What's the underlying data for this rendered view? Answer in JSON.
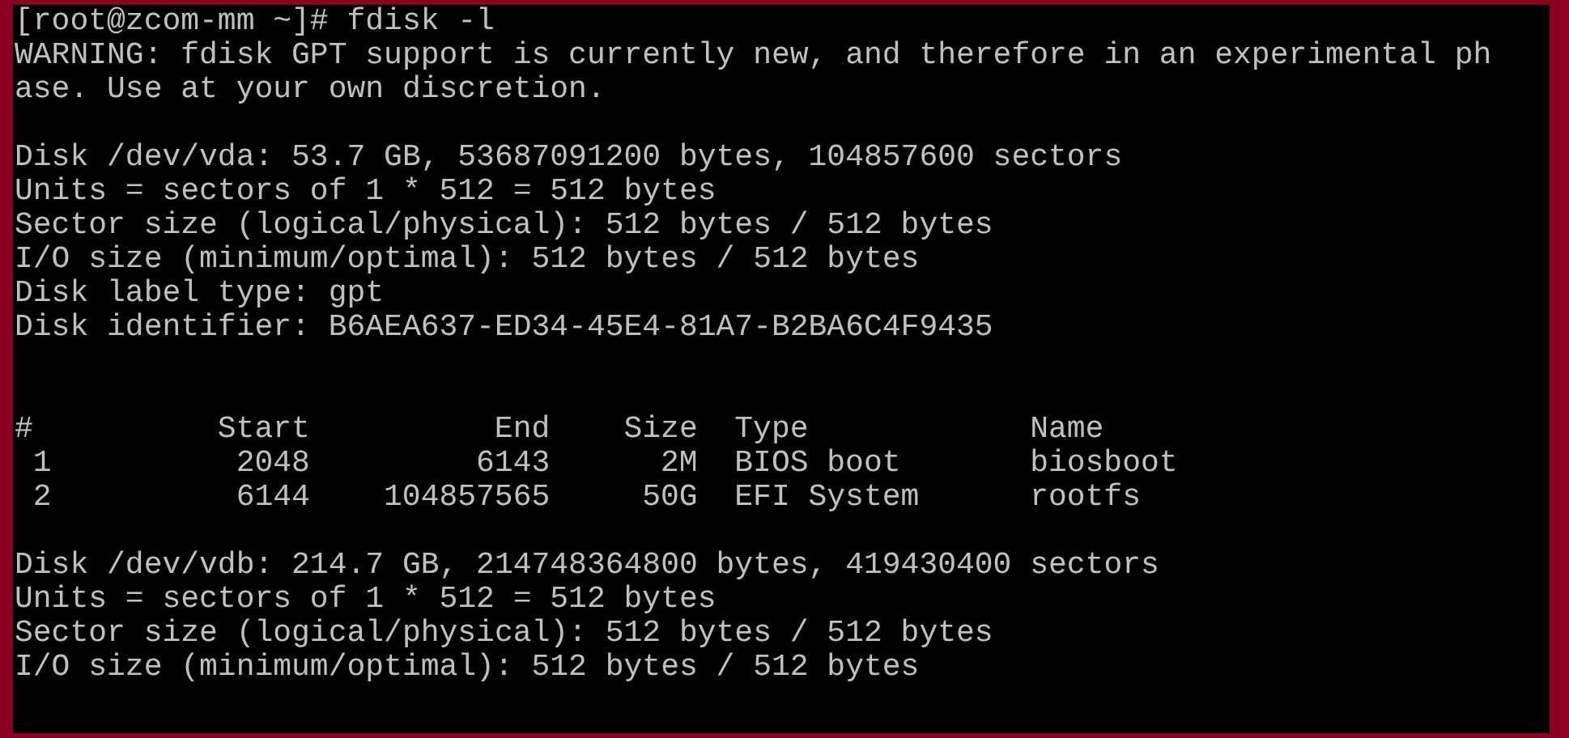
{
  "terminal": {
    "blocks": [
      {
        "kind": "text",
        "lines": [
          "[root@zcom-mm ~]# fdisk -l",
          "WARNING: fdisk GPT support is currently new, and therefore in an experimental ph",
          "ase. Use at your own discretion."
        ]
      },
      {
        "kind": "text",
        "lines": [
          "Disk /dev/vda: 53.7 GB, 53687091200 bytes, 104857600 sectors",
          "Units = sectors of 1 * 512 = 512 bytes",
          "Sector size (logical/physical): 512 bytes / 512 bytes",
          "I/O size (minimum/optimal): 512 bytes / 512 bytes",
          "Disk label type: gpt",
          "Disk identifier: B6AEA637-ED34-45E4-81A7-B2BA6C4F9435"
        ]
      },
      {
        "kind": "table",
        "columns": [
          "#",
          "Start",
          "End",
          "Size",
          "Type",
          "Name"
        ],
        "rows": [
          [
            "1",
            "2048",
            "6143",
            "2M",
            "BIOS boot",
            "biosboot"
          ],
          [
            "2",
            "6144",
            "104857565",
            "50G",
            "EFI System",
            "rootfs"
          ]
        ]
      },
      {
        "kind": "text",
        "lines": [
          "Disk /dev/vdb: 214.7 GB, 214748364800 bytes, 419430400 sectors",
          "Units = sectors of 1 * 512 = 512 bytes",
          "Sector size (logical/physical): 512 bytes / 512 bytes",
          "I/O size (minimum/optimal): 512 bytes / 512 bytes"
        ]
      }
    ]
  }
}
